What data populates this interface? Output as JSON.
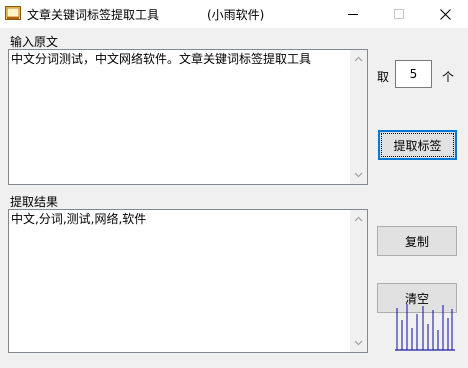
{
  "window": {
    "title": "文章关键词标签提取工具",
    "title_suffix": "(小雨软件)"
  },
  "input_section": {
    "label": "输入原文",
    "text": "中文分词测试，中文网络软件。文章关键词标签提取工具"
  },
  "count": {
    "prefix_label": "取",
    "value": "5",
    "suffix_label": "个"
  },
  "buttons": {
    "extract": "提取标签",
    "copy": "复制",
    "clear": "清空"
  },
  "result_section": {
    "label": "提取结果",
    "text": "中文,分词,测试,网络,软件"
  },
  "colors": {
    "focus_border": "#0078d7",
    "wave": "#1f1fa8"
  }
}
